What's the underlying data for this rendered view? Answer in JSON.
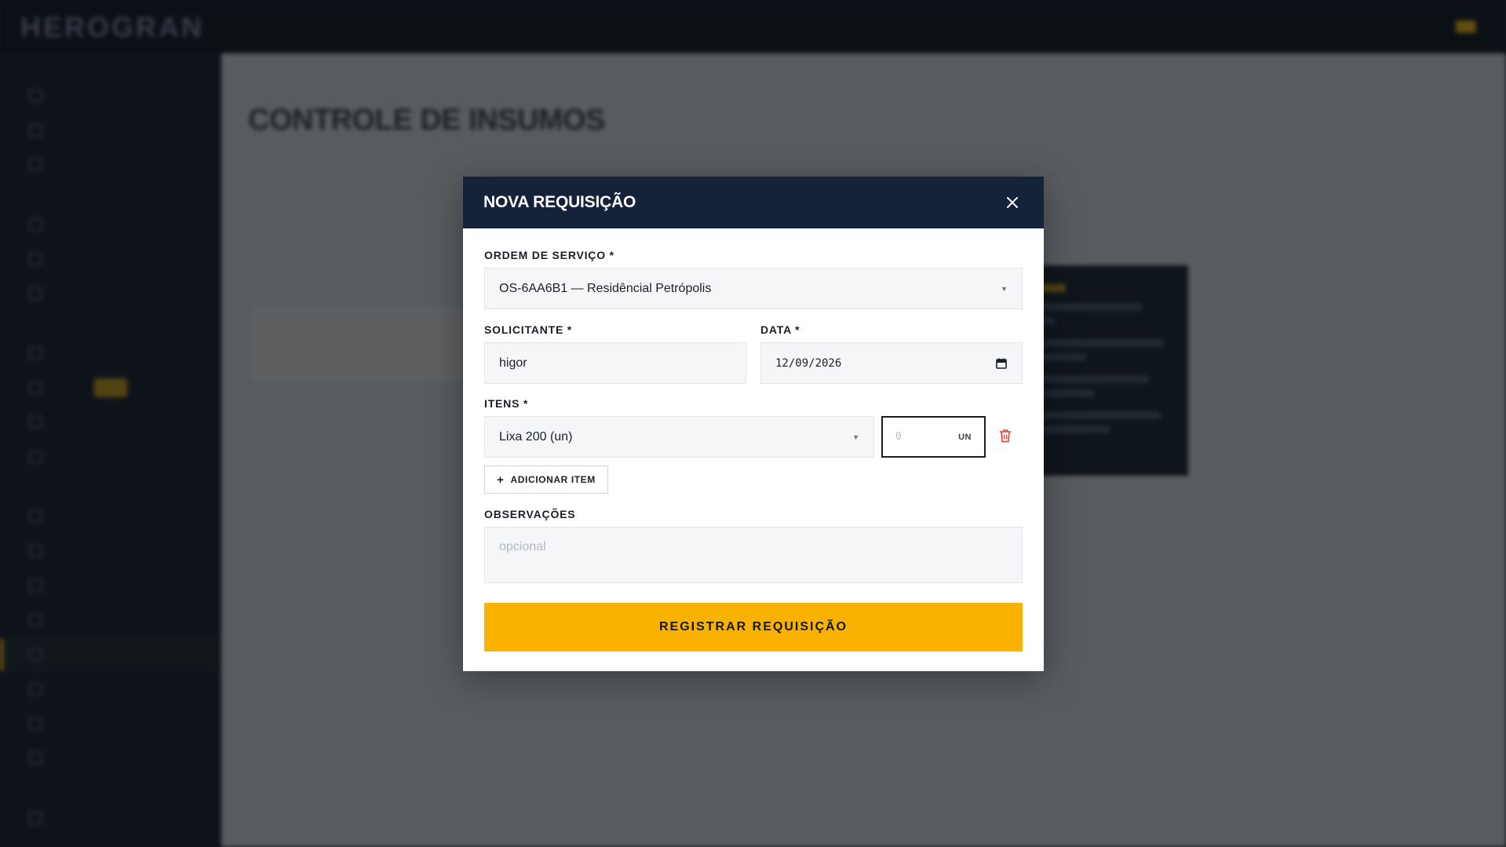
{
  "app": {
    "logo": "HEROGRAN"
  },
  "sidebar": {
    "sections": [
      {
        "title": "",
        "items": [
          "",
          "",
          ""
        ]
      },
      {
        "title": "",
        "items": [
          "",
          "",
          ""
        ]
      },
      {
        "title": "",
        "items": [
          "",
          "",
          "",
          ""
        ]
      },
      {
        "title": "",
        "items": [
          "",
          "",
          "",
          "",
          "",
          "",
          "",
          ""
        ]
      },
      {
        "title": "",
        "items": [
          ""
        ]
      }
    ]
  },
  "page": {
    "title": "CONTROLE DE INSUMOS"
  },
  "modal": {
    "title": "NOVA REQUISIÇÃO",
    "fields": {
      "ordem_servico": {
        "label": "ORDEM DE SERVIÇO *",
        "value": "OS-6AA6B1 — Residêncial Petrópolis"
      },
      "solicitante": {
        "label": "SOLICITANTE *",
        "value": "higor"
      },
      "data": {
        "label": "DATA *",
        "value": "12/09/2026"
      },
      "itens": {
        "label": "ITENS *",
        "item_value": "Lixa 200 (un)",
        "qty_placeholder": "0",
        "unit": "UN",
        "add_label": "ADICIONAR ITEM"
      },
      "observacoes": {
        "label": "OBSERVAÇÕES",
        "placeholder": "opcional"
      }
    },
    "submit_label": "REGISTRAR REQUISIÇÃO"
  },
  "colors": {
    "accent": "#f9b200",
    "header": "#14233a",
    "danger": "#e0413b"
  }
}
